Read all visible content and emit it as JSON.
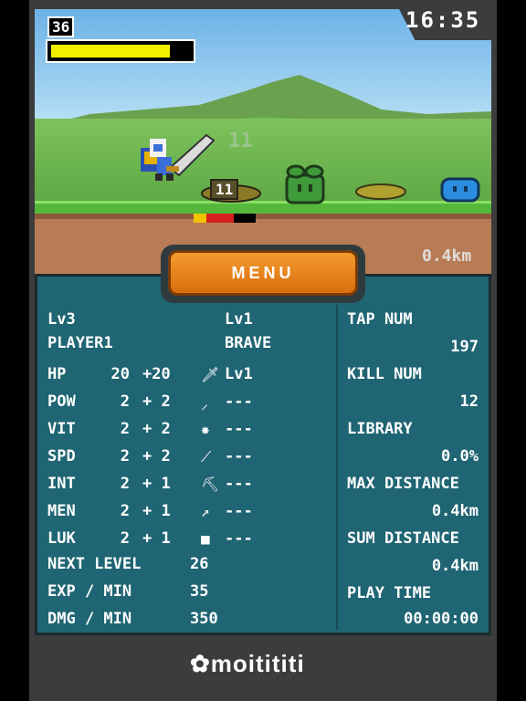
{
  "hud": {
    "level_badge": "36",
    "hp_fraction": 0.88,
    "clock": "16:35",
    "distance": "0.4km",
    "floating_damage": "11",
    "damage_label": "11",
    "enemy_hp_fraction": 0.65
  },
  "menu_button": {
    "label": "MENU"
  },
  "player": {
    "level": "Lv3",
    "name": "PLAYER1"
  },
  "weapon": {
    "level": "Lv1",
    "name": "BRAVE"
  },
  "stats": [
    {
      "name": "HP",
      "base": "20",
      "bonus": "+20"
    },
    {
      "name": "POW",
      "base": "2",
      "bonus": "+ 2"
    },
    {
      "name": "VIT",
      "base": "2",
      "bonus": "+ 2"
    },
    {
      "name": "SPD",
      "base": "2",
      "bonus": "+ 2"
    },
    {
      "name": "INT",
      "base": "2",
      "bonus": "+ 1"
    },
    {
      "name": "MEN",
      "base": "2",
      "bonus": "+ 1"
    },
    {
      "name": "LUK",
      "base": "2",
      "bonus": "+ 1"
    }
  ],
  "equipment": [
    {
      "icon": "sword-icon",
      "value": "Lv1"
    },
    {
      "icon": "dagger-icon",
      "value": "---"
    },
    {
      "icon": "armor-icon",
      "value": "---"
    },
    {
      "icon": "bow-icon",
      "value": "---"
    },
    {
      "icon": "pickaxe-icon",
      "value": "---"
    },
    {
      "icon": "staff-icon",
      "value": "---"
    },
    {
      "icon": "dice-icon",
      "value": "---"
    }
  ],
  "progress": {
    "next_level_label": "NEXT LEVEL",
    "next_level_value": "26",
    "exp_min_label": "EXP / MIN",
    "exp_min_value": "35",
    "dmg_min_label": "DMG / MIN",
    "dmg_min_value": "350"
  },
  "records": [
    {
      "label": "TAP NUM",
      "value": "197"
    },
    {
      "label": "KILL NUM",
      "value": "12"
    },
    {
      "label": "LIBRARY",
      "value": "0.0%"
    },
    {
      "label": "MAX DISTANCE",
      "value": "0.4km"
    },
    {
      "label": "SUM DISTANCE",
      "value": "0.4km"
    },
    {
      "label": "PLAY TIME",
      "value": "00:00:00"
    }
  ],
  "footer": {
    "brand": "moitititi"
  },
  "colors": {
    "panel_bg": "#1f6573",
    "menu_orange": "#f08a1e",
    "hp_yellow": "#f0f000"
  }
}
